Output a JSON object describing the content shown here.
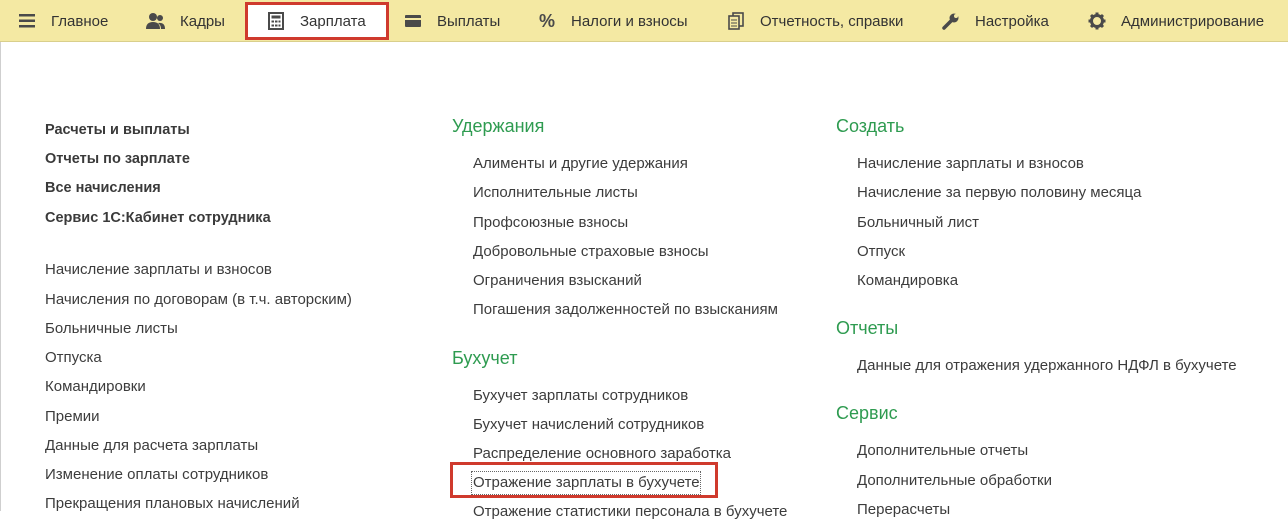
{
  "topnav": [
    {
      "label": "Главное",
      "icon": "menu-icon"
    },
    {
      "label": "Кадры",
      "icon": "people-icon"
    },
    {
      "label": "Зарплата",
      "icon": "calculator-icon"
    },
    {
      "label": "Выплаты",
      "icon": "wallet-icon"
    },
    {
      "label": "Налоги и взносы",
      "icon": "percent-icon"
    },
    {
      "label": "Отчетность, справки",
      "icon": "documents-icon"
    },
    {
      "label": "Настройка",
      "icon": "wrench-icon"
    },
    {
      "label": "Администрирование",
      "icon": "gear-icon"
    }
  ],
  "active_tab": "Зарплата",
  "left": {
    "main_links": [
      "Расчеты и выплаты",
      "Отчеты по зарплате",
      "Все начисления",
      "Сервис 1С:Кабинет сотрудника"
    ],
    "links": [
      "Начисление зарплаты и взносов",
      "Начисления по договорам (в т.ч. авторским)",
      "Больничные листы",
      "Отпуска",
      "Командировки",
      "Премии",
      "Данные для расчета зарплаты",
      "Изменение оплаты сотрудников",
      "Прекращения плановых начислений"
    ]
  },
  "middle": {
    "sections": [
      {
        "title": "Удержания",
        "items": [
          "Алименты и другие удержания",
          "Исполнительные листы",
          "Профсоюзные взносы",
          "Добровольные страховые взносы",
          "Ограничения взысканий",
          "Погашения задолженностей по взысканиям"
        ]
      },
      {
        "title": "Бухучет",
        "items": [
          "Бухучет зарплаты сотрудников",
          "Бухучет начислений сотрудников",
          "Распределение основного заработка",
          "Отражение зарплаты в бухучете",
          "Отражение статистики персонала в бухучете"
        ]
      }
    ]
  },
  "right": {
    "sections": [
      {
        "title": "Создать",
        "items": [
          "Начисление зарплаты и взносов",
          "Начисление за первую половину месяца",
          "Больничный лист",
          "Отпуск",
          "Командировка"
        ]
      },
      {
        "title": "Отчеты",
        "items": [
          "Данные для отражения удержанного НДФЛ в бухучете"
        ]
      },
      {
        "title": "Сервис",
        "items": [
          "Дополнительные отчеты",
          "Дополнительные обработки",
          "Перерасчеты"
        ]
      }
    ]
  },
  "highlighted_item": "Отражение зарплаты в бухучете",
  "colors": {
    "topbar": "#f4e9a3",
    "section_title": "#2e9b50",
    "highlight": "#cf3a2d"
  }
}
